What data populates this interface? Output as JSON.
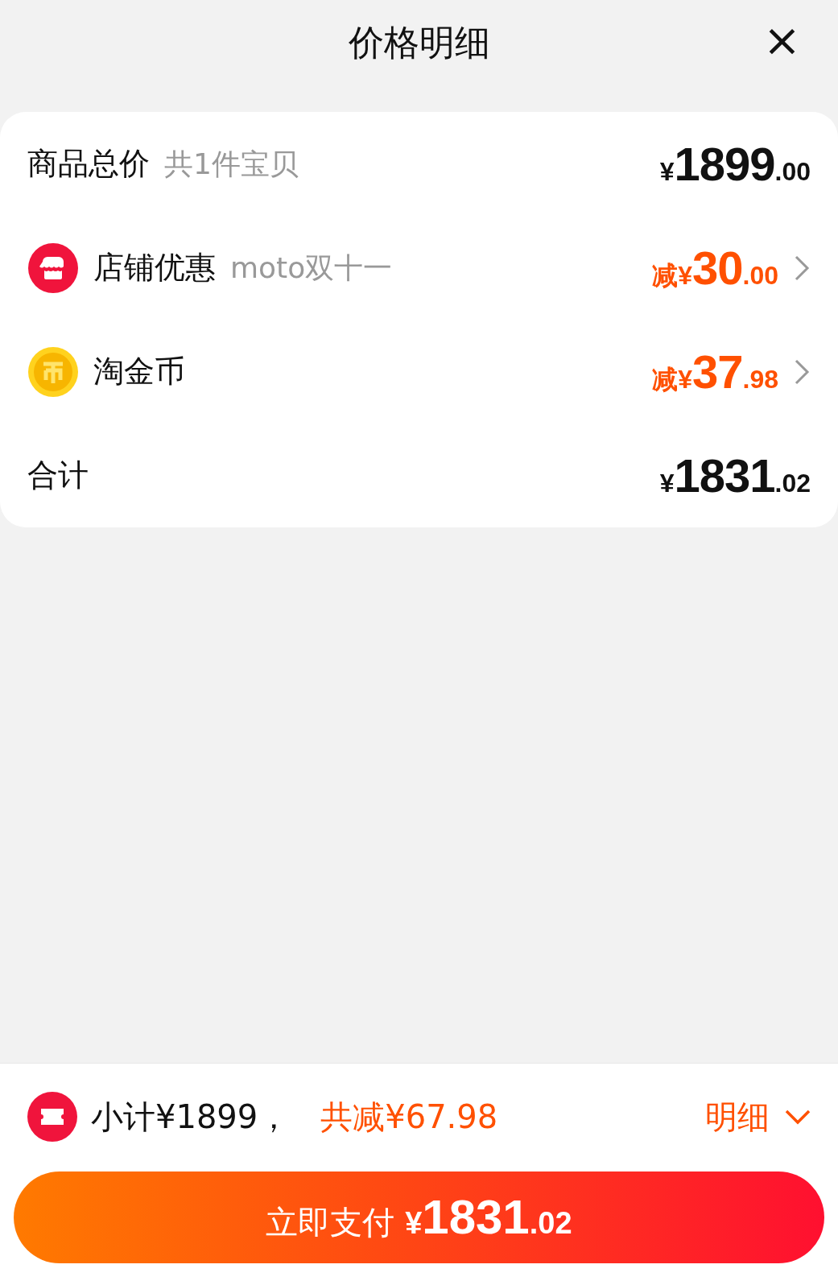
{
  "header": {
    "title": "价格明细",
    "close": "×"
  },
  "rows": [
    {
      "kind": "total",
      "label": "商品总价",
      "note": "共1件宝贝",
      "price": {
        "prefix": "¥",
        "integer": "1899",
        "decimal": ".00"
      }
    },
    {
      "kind": "shop",
      "label": "店铺优惠",
      "note": "moto双十一",
      "price": {
        "prefix": "减¥",
        "integer": "30",
        "decimal": ".00"
      }
    },
    {
      "kind": "coin",
      "label": "淘金币",
      "price": {
        "prefix": "减¥",
        "integer": "37",
        "decimal": ".98"
      }
    },
    {
      "kind": "sum",
      "label": "合计",
      "price": {
        "prefix": "¥",
        "integer": "1831",
        "decimal": ".02"
      }
    }
  ],
  "summary": {
    "subtotal": "小计¥1899，",
    "saved": "共减¥67.98",
    "details": "明细"
  },
  "pay_button": {
    "label": "立即支付",
    "prefix": "¥",
    "integer": "1831",
    "decimal": ".02"
  }
}
